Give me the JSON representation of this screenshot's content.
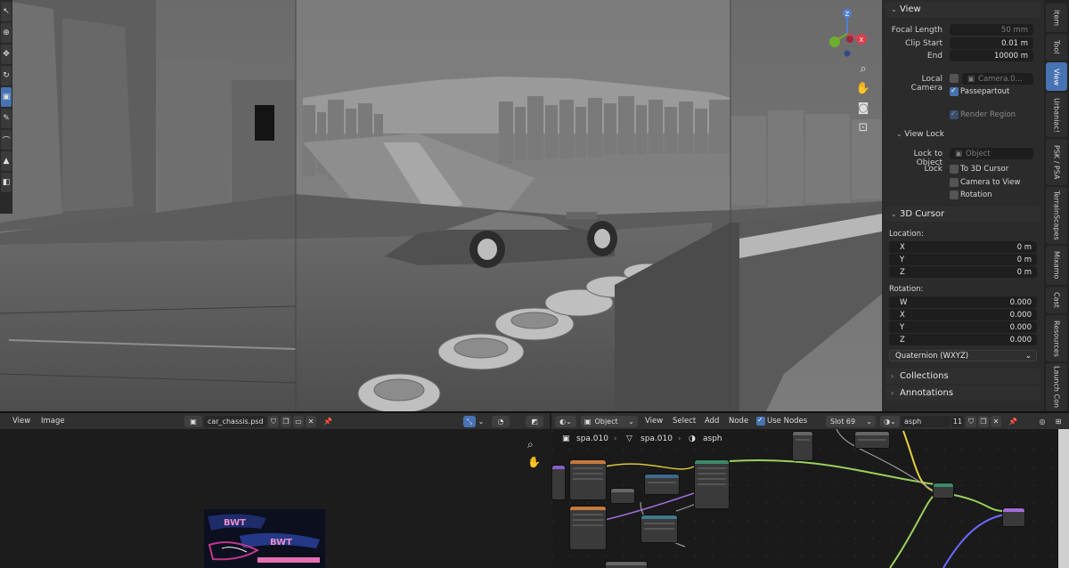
{
  "viewport": {
    "npanel": {
      "view_section": {
        "title": "View",
        "focal_length_label": "Focal Length",
        "focal_length_value": "50 mm",
        "clip_start_label": "Clip Start",
        "clip_start_value": "0.01 m",
        "end_label": "End",
        "end_value": "10000 m",
        "local_camera_label": "Local Camera",
        "local_camera_value": "Camera.0...",
        "passepartout_label": "Passepartout",
        "render_region_label": "Render Region"
      },
      "view_lock_section": {
        "title": "View Lock",
        "lock_to_object_label": "Lock to Object",
        "lock_to_object_placeholder": "Object",
        "lock_label": "Lock",
        "to_3d_cursor_label": "To 3D Cursor",
        "camera_to_view_label": "Camera to View",
        "rotation_label": "Rotation"
      },
      "cursor_section": {
        "title": "3D Cursor",
        "location_label": "Location:",
        "x_label": "X",
        "x_value": "0 m",
        "y_label": "Y",
        "y_value": "0 m",
        "z_label": "Z",
        "z_value": "0 m",
        "rotation_label": "Rotation:",
        "rw_label": "W",
        "rw_value": "0.000",
        "rx_label": "X",
        "rx_value": "0.000",
        "ry_label": "Y",
        "ry_value": "0.000",
        "rz_label": "Z",
        "rz_value": "0.000",
        "rotation_mode": "Quaternion (WXYZ)"
      },
      "collections_title": "Collections",
      "annotations_title": "Annotations"
    },
    "tabs": [
      "Item",
      "Tool",
      "View",
      "Urbaniac!",
      "PSK / PSA",
      "TerrainScapes",
      "Mixamo",
      "Cast",
      "Resources",
      "Launch Con"
    ],
    "gizmo": {
      "z_label": "Z",
      "x_label": "X"
    }
  },
  "image_editor": {
    "view_menu": "View",
    "image_menu": "Image",
    "image_name": "car_chassis.psd"
  },
  "node_editor": {
    "object_dropdown": "Object",
    "view_menu": "View",
    "select_menu": "Select",
    "add_menu": "Add",
    "node_menu": "Node",
    "use_nodes_label": "Use Nodes",
    "slot_label": "Slot 69",
    "material_name": "asph",
    "user_count": "11",
    "breadcrumb": [
      "spa.010",
      "spa.010",
      "asph"
    ]
  },
  "colors": {
    "accent": "#4772b3",
    "panel_bg": "#2b2b2b",
    "field_bg": "#1e1e1e",
    "gizmo_z": "#4f7fd8",
    "gizmo_x": "#d8404f",
    "gizmo_y": "#6fae2c"
  }
}
